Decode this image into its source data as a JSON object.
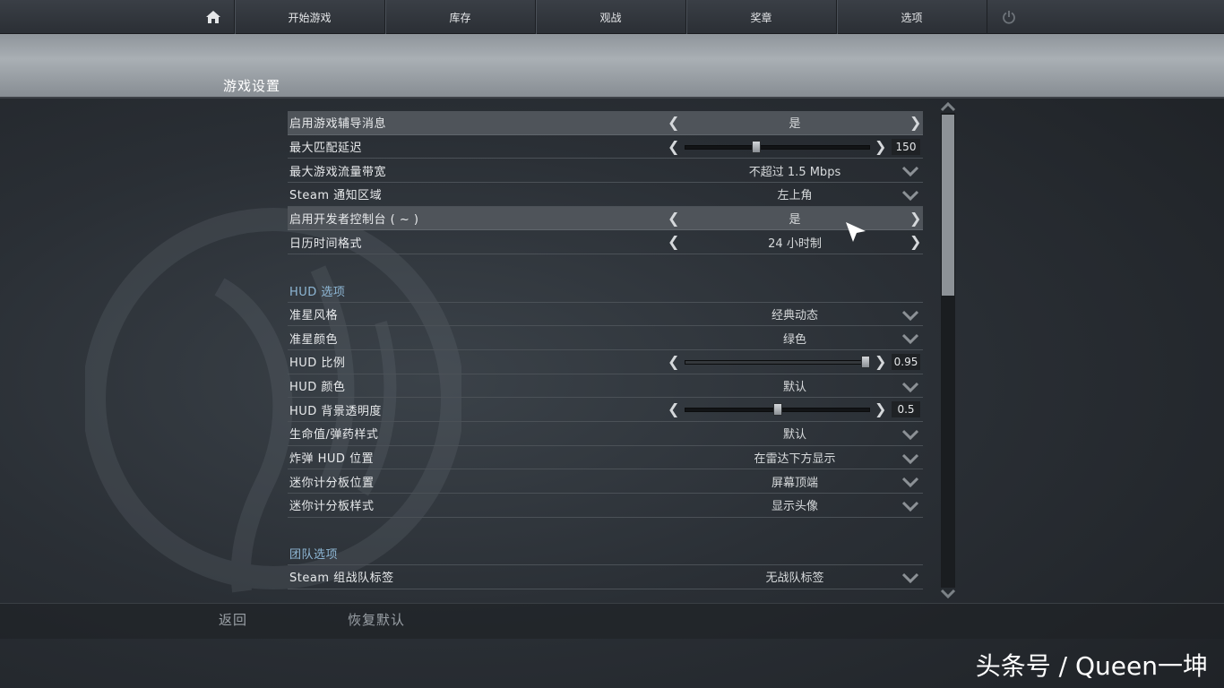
{
  "nav": {
    "home_icon": "home-icon",
    "items": [
      "开始游戏",
      "库存",
      "观战",
      "奖章",
      "选项"
    ],
    "power_icon": "power-icon"
  },
  "page_title": "游戏设置",
  "settings": {
    "general": [
      {
        "label": "启用游戏辅导消息",
        "type": "toggle",
        "value": "是"
      },
      {
        "label": "最大匹配延迟",
        "type": "slider",
        "value": "150",
        "level": 0.4
      },
      {
        "label": "最大游戏流量带宽",
        "type": "dropdown",
        "value": "不超过 1.5 Mbps"
      },
      {
        "label": "Steam 通知区域",
        "type": "dropdown",
        "value": "左上角"
      },
      {
        "label": "启用开发者控制台 ( ~ )",
        "type": "toggle",
        "value": "是"
      },
      {
        "label": "日历时间格式",
        "type": "toggle",
        "value": "24 小时制"
      }
    ],
    "hud_title": "HUD 选项",
    "hud": [
      {
        "label": "准星风格",
        "type": "dropdown",
        "value": "经典动态"
      },
      {
        "label": "准星颜色",
        "type": "dropdown",
        "value": "绿色"
      },
      {
        "label": "HUD 比例",
        "type": "slider",
        "value": "0.95",
        "level": 0.98
      },
      {
        "label": "HUD 颜色",
        "type": "dropdown",
        "value": "默认"
      },
      {
        "label": "HUD 背景透明度",
        "type": "slider",
        "value": "0.5",
        "level": 0.5
      },
      {
        "label": "生命值/弹药样式",
        "type": "dropdown",
        "value": "默认"
      },
      {
        "label": "炸弹 HUD 位置",
        "type": "dropdown",
        "value": "在雷达下方显示"
      },
      {
        "label": "迷你计分板位置",
        "type": "dropdown",
        "value": "屏幕顶端"
      },
      {
        "label": "迷你计分板样式",
        "type": "dropdown",
        "value": "显示头像"
      }
    ],
    "team_title": "团队选项",
    "team": [
      {
        "label": "Steam 组战队标签",
        "type": "dropdown",
        "value": "无战队标签"
      }
    ]
  },
  "footer": {
    "back": "返回",
    "restore": "恢复默认"
  },
  "watermark": "头条号 / Queen一坤",
  "colors": {
    "section_title": "#8fb8d6",
    "highlight_row": "#4f545a"
  }
}
